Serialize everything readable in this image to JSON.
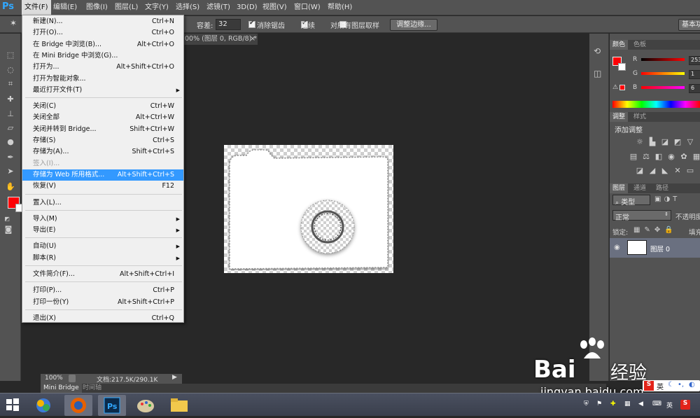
{
  "app": {
    "logo": "Ps"
  },
  "menubar": [
    "文件(F)",
    "编辑(E)",
    "图像(I)",
    "图层(L)",
    "文字(Y)",
    "选择(S)",
    "滤镜(T)",
    "3D(D)",
    "视图(V)",
    "窗口(W)",
    "帮助(H)"
  ],
  "options": {
    "tolerance_label": "容差:",
    "tolerance_value": "32",
    "antialias_label": "消除锯齿",
    "contiguous_label": "连续",
    "all_layers_label": "对所有图层取样",
    "refine_edge_button": "调整边缘...",
    "workspace_button": "基本功"
  },
  "document": {
    "tab_title": "00% (图层 0, RGB/8) *",
    "close": "×"
  },
  "status": {
    "zoom": "100%",
    "doc_info": "文档:217.5K/290.1K"
  },
  "bottom_tabs": [
    "Mini Bridge",
    "时间轴"
  ],
  "file_menu": [
    {
      "label": "新建(N)...",
      "shortcut": "Ctrl+N"
    },
    {
      "label": "打开(O)...",
      "shortcut": "Ctrl+O"
    },
    {
      "label": "在 Bridge 中浏览(B)...",
      "shortcut": "Alt+Ctrl+O"
    },
    {
      "label": "在 Mini Bridge 中浏览(G)...",
      "shortcut": ""
    },
    {
      "label": "打开为...",
      "shortcut": "Alt+Shift+Ctrl+O"
    },
    {
      "label": "打开为智能对象...",
      "shortcut": ""
    },
    {
      "label": "最近打开文件(T)",
      "shortcut": "",
      "submenu": true
    },
    {
      "sep": true
    },
    {
      "label": "关闭(C)",
      "shortcut": "Ctrl+W"
    },
    {
      "label": "关闭全部",
      "shortcut": "Alt+Ctrl+W"
    },
    {
      "label": "关闭并转到 Bridge...",
      "shortcut": "Shift+Ctrl+W"
    },
    {
      "label": "存储(S)",
      "shortcut": "Ctrl+S"
    },
    {
      "label": "存储为(A)...",
      "shortcut": "Shift+Ctrl+S"
    },
    {
      "label": "签入(I)...",
      "shortcut": "",
      "disabled": true
    },
    {
      "label": "存储为 Web 所用格式...",
      "shortcut": "Alt+Shift+Ctrl+S",
      "highlighted": true
    },
    {
      "label": "恢复(V)",
      "shortcut": "F12"
    },
    {
      "sep": true
    },
    {
      "label": "置入(L)...",
      "shortcut": ""
    },
    {
      "sep": true
    },
    {
      "label": "导入(M)",
      "shortcut": "",
      "submenu": true
    },
    {
      "label": "导出(E)",
      "shortcut": "",
      "submenu": true
    },
    {
      "sep": true
    },
    {
      "label": "自动(U)",
      "shortcut": "",
      "submenu": true
    },
    {
      "label": "脚本(R)",
      "shortcut": "",
      "submenu": true
    },
    {
      "sep": true
    },
    {
      "label": "文件简介(F)...",
      "shortcut": "Alt+Shift+Ctrl+I"
    },
    {
      "sep": true
    },
    {
      "label": "打印(P)...",
      "shortcut": "Ctrl+P"
    },
    {
      "label": "打印一份(Y)",
      "shortcut": "Alt+Shift+Ctrl+P"
    },
    {
      "sep": true
    },
    {
      "label": "退出(X)",
      "shortcut": "Ctrl+Q"
    }
  ],
  "color_panel": {
    "tabs": [
      "颜色",
      "色板"
    ],
    "r_label": "R",
    "g_label": "G",
    "b_label": "B",
    "r_value": "253",
    "g_value": "1",
    "b_value": "6",
    "foreground": "#fd0106"
  },
  "adjust_panel": {
    "tabs": [
      "调整",
      "样式"
    ],
    "title": "添加调整"
  },
  "layers_panel": {
    "tabs": [
      "图层",
      "通道",
      "路径"
    ],
    "kind_label": "类型",
    "blend_mode": "正常",
    "opacity_label": "不透明度",
    "lock_label": "锁定:",
    "fill_label": "填充",
    "layer_name": "图层 0"
  },
  "watermark": {
    "brand": "Bai",
    "brand2": "经验",
    "url": "jingyan.baidu.com"
  },
  "tray": {
    "ime": "英",
    "lang": "英"
  }
}
